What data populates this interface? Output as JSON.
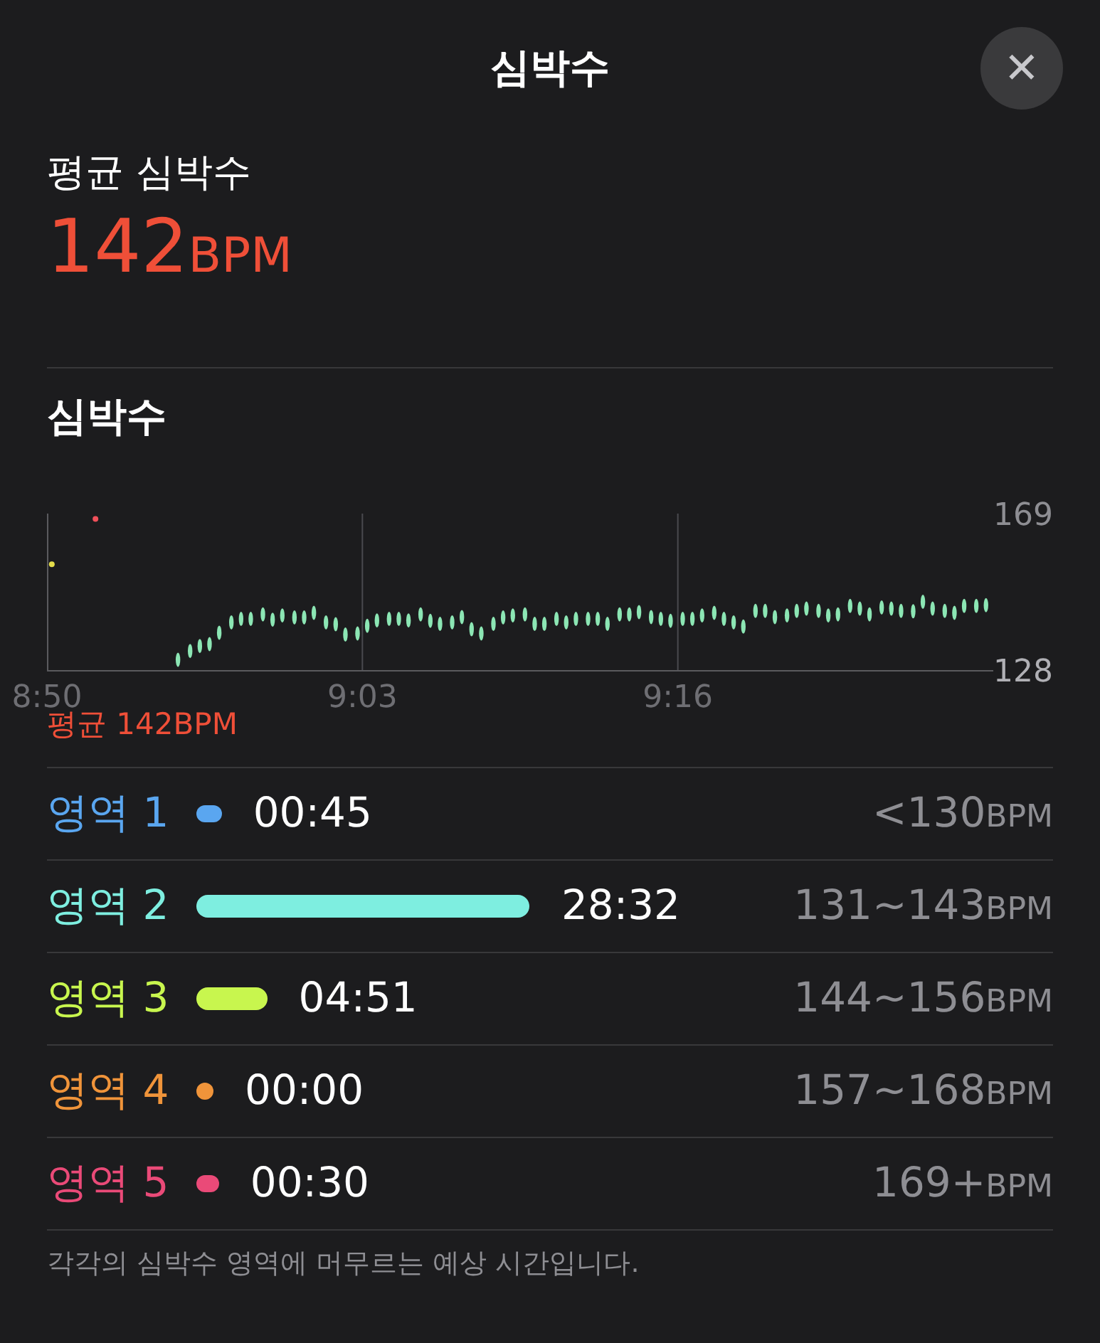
{
  "header": {
    "title": "심박수",
    "close_label": "✕"
  },
  "average": {
    "label": "평균 심박수",
    "value": "142",
    "unit": "BPM"
  },
  "heart_rate": {
    "title": "심박수",
    "avg_label": "평균 142BPM",
    "chart_data": {
      "type": "scatter",
      "xlim": [
        530,
        569
      ],
      "ylim": [
        128,
        169
      ],
      "xticks": [
        {
          "value": 530,
          "label": "8:50"
        },
        {
          "value": 543,
          "label": "9:03"
        },
        {
          "value": 556,
          "label": "9:16"
        }
      ],
      "yticks": [
        128,
        169
      ],
      "x": [
        530.2,
        532.0,
        535.4,
        535.9,
        536.3,
        536.7,
        537.1,
        537.6,
        538.0,
        538.4,
        538.9,
        539.3,
        539.7,
        540.2,
        540.6,
        541.0,
        541.5,
        541.9,
        542.3,
        542.8,
        543.2,
        543.6,
        544.1,
        544.5,
        544.9,
        545.4,
        545.8,
        546.2,
        546.7,
        547.1,
        547.5,
        547.9,
        548.4,
        548.8,
        549.2,
        549.7,
        550.1,
        550.5,
        551.0,
        551.4,
        551.8,
        552.3,
        552.7,
        553.1,
        553.6,
        554.0,
        554.4,
        554.9,
        555.3,
        555.7,
        556.2,
        556.6,
        557.0,
        557.5,
        557.9,
        558.3,
        558.7,
        559.2,
        559.6,
        560.0,
        560.5,
        560.9,
        561.3,
        561.8,
        562.2,
        562.6,
        563.1,
        563.5,
        563.9,
        564.4,
        564.8,
        565.2,
        565.7,
        566.1,
        566.5,
        567.0,
        567.4,
        567.8,
        568.3,
        568.7
      ],
      "series": [
        {
          "color": "#e4dd4b",
          "values": [
            155.7,
            null,
            null,
            null,
            null,
            null,
            null,
            null,
            null,
            null,
            null,
            null,
            null,
            null,
            null,
            null,
            null,
            null,
            null,
            null,
            null,
            null,
            null,
            null,
            null,
            null,
            null,
            null,
            null,
            null,
            null,
            null,
            null,
            null,
            null,
            null,
            null,
            null,
            null,
            null,
            null,
            null,
            null,
            null,
            null,
            null,
            null,
            null,
            null,
            null,
            null,
            null,
            null,
            null,
            null,
            null,
            null,
            null,
            null,
            null,
            null,
            null,
            null,
            null,
            null,
            null,
            null,
            null,
            null,
            null,
            null,
            null,
            null,
            null,
            null,
            null,
            null,
            null,
            null,
            null
          ]
        },
        {
          "color": "#f0505a",
          "values": [
            null,
            167.6,
            null,
            null,
            null,
            null,
            null,
            null,
            null,
            null,
            null,
            null,
            null,
            null,
            null,
            null,
            null,
            null,
            null,
            null,
            null,
            null,
            null,
            null,
            null,
            null,
            null,
            null,
            null,
            null,
            null,
            null,
            null,
            null,
            null,
            null,
            null,
            null,
            null,
            null,
            null,
            null,
            null,
            null,
            null,
            null,
            null,
            null,
            null,
            null,
            null,
            null,
            null,
            null,
            null,
            null,
            null,
            null,
            null,
            null,
            null,
            null,
            null,
            null,
            null,
            null,
            null,
            null,
            null,
            null,
            null,
            null,
            null,
            null,
            null,
            null,
            null,
            null,
            null,
            null
          ]
        },
        {
          "color": "#8ce6b4",
          "values": [
            null,
            null,
            130.7,
            133,
            134.3,
            134.8,
            137.8,
            140.5,
            141.4,
            141.4,
            142.6,
            141.2,
            142.3,
            141.8,
            141.8,
            143,
            140.5,
            140,
            137.3,
            137.6,
            139.6,
            141,
            141.4,
            141.4,
            141,
            142.6,
            140.9,
            140.1,
            140.5,
            141.9,
            138.7,
            137.6,
            140.1,
            141.8,
            142.3,
            142.6,
            140.1,
            140.1,
            141.4,
            140.5,
            141.4,
            141.4,
            141.4,
            140.1,
            142.6,
            142.6,
            143.2,
            141.9,
            141.4,
            140.9,
            141.4,
            141.4,
            142.3,
            143,
            141.4,
            140.5,
            139.4,
            143.5,
            143.5,
            141.9,
            142.3,
            143.5,
            144.1,
            143.5,
            142.3,
            142.6,
            144.8,
            144.1,
            142.6,
            144.4,
            144.1,
            143.5,
            143.4,
            145.9,
            144.1,
            143.5,
            143,
            144.8,
            144.8,
            145
          ]
        }
      ]
    }
  },
  "zones": [
    {
      "label": "영역 1",
      "color": "#5aa6f0",
      "time": "00:45",
      "range": "<130",
      "unit": "BPM"
    },
    {
      "label": "영역 2",
      "color": "#7eeee0",
      "time": "28:32",
      "range": "131~143",
      "unit": "BPM"
    },
    {
      "label": "영역 3",
      "color": "#c8f64e",
      "time": "04:51",
      "range": "144~156",
      "unit": "BPM"
    },
    {
      "label": "영역 4",
      "color": "#f0943a",
      "time": "00:00",
      "range": "157~168",
      "unit": "BPM"
    },
    {
      "label": "영역 5",
      "color": "#ea4a78",
      "time": "00:30",
      "range": "169+",
      "unit": "BPM"
    }
  ],
  "note": "각각의 심박수 영역에 머무르는 예상 시간입니다."
}
